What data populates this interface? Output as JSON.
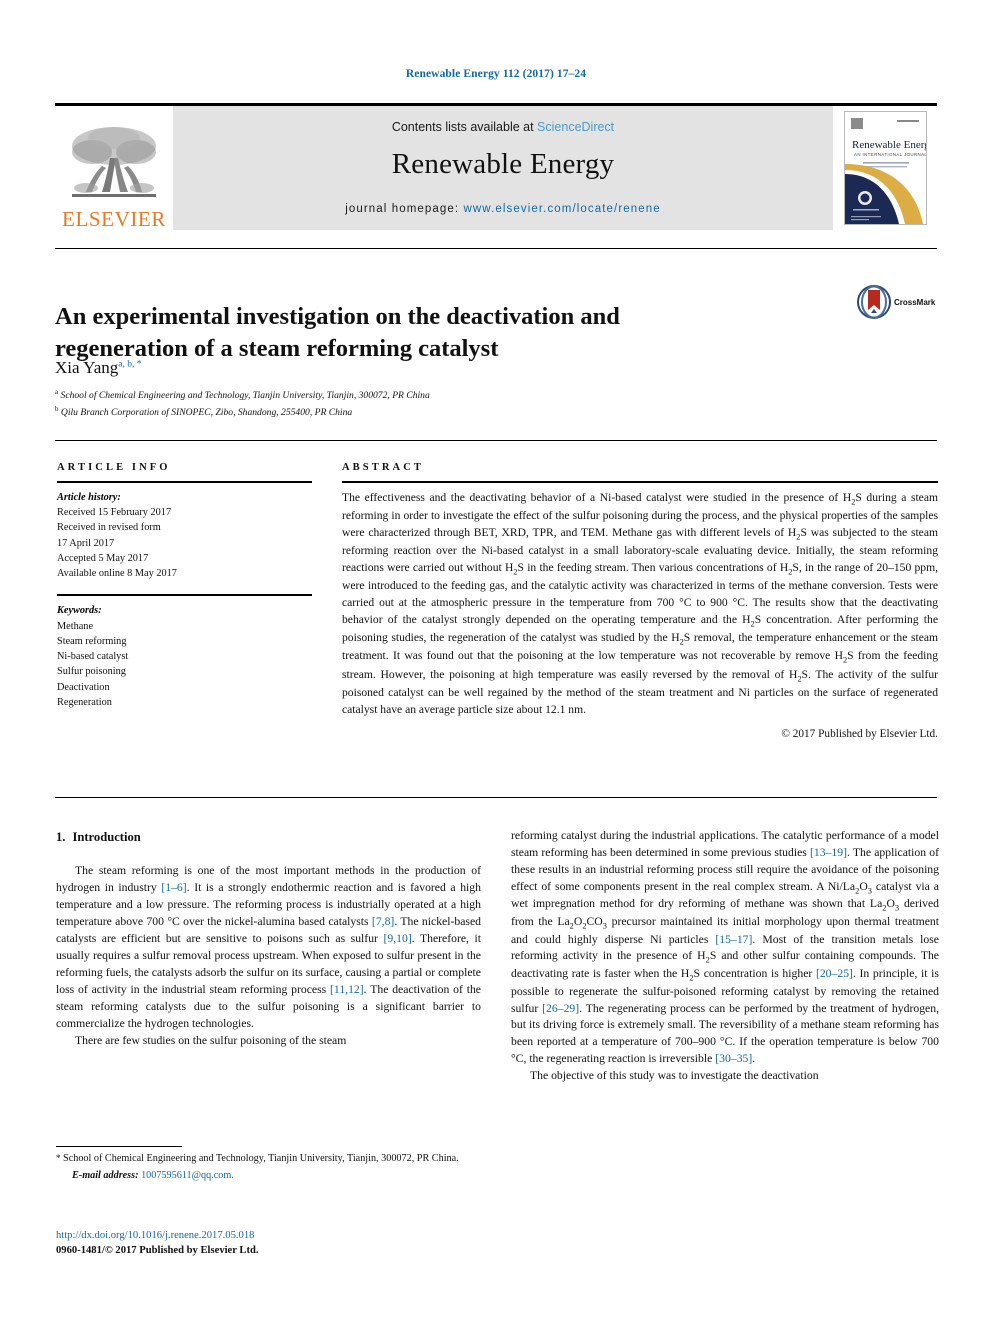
{
  "running_head": "Renewable Energy 112 (2017) 17–24",
  "masthead": {
    "publisher_name": "ELSEVIER",
    "contents_prefix": "Contents lists available at ",
    "contents_link": "ScienceDirect",
    "journal_name": "Renewable Energy",
    "homepage_label": "journal homepage:",
    "homepage_url": "www.elsevier.com/locate/renene",
    "cover": {
      "title": "Renewable Energy",
      "subtitle": "AN INTERNATIONAL JOURNAL"
    }
  },
  "article": {
    "title": "An experimental investigation on the deactivation and regeneration of a steam reforming catalyst",
    "crossmark_label": "CrossMark",
    "author": "Xia Yang",
    "author_marks": "a, b, *",
    "affiliations": [
      {
        "mark": "a",
        "text": "School of Chemical Engineering and Technology, Tianjin University, Tianjin, 300072, PR China"
      },
      {
        "mark": "b",
        "text": "Qilu Branch Corporation of SINOPEC, Zibo, Shandong, 255400, PR China"
      }
    ]
  },
  "article_info": {
    "heading": "ARTICLE INFO",
    "history_label": "Article history:",
    "history": [
      "Received 15 February 2017",
      "Received in revised form",
      "17 April 2017",
      "Accepted 5 May 2017",
      "Available online 8 May 2017"
    ],
    "keywords_label": "Keywords:",
    "keywords": [
      "Methane",
      "Steam reforming",
      "Ni-based catalyst",
      "Sulfur poisoning",
      "Deactivation",
      "Regeneration"
    ]
  },
  "abstract": {
    "heading": "ABSTRACT",
    "body": "The effectiveness and the deactivating behavior of a Ni-based catalyst were studied in the presence of H2S during a steam reforming in order to investigate the effect of the sulfur poisoning during the process, and the physical properties of the samples were characterized through BET, XRD, TPR, and TEM. Methane gas with different levels of H2S was subjected to the steam reforming reaction over the Ni-based catalyst in a small laboratory-scale evaluating device. Initially, the steam reforming reactions were carried out without H2S in the feeding stream. Then various concentrations of H2S, in the range of 20–150 ppm, were introduced to the feeding gas, and the catalytic activity was characterized in terms of the methane conversion. Tests were carried out at the atmospheric pressure in the temperature from 700 °C to 900 °C. The results show that the deactivating behavior of the catalyst strongly depended on the operating temperature and the H2S concentration. After performing the poisoning studies, the regeneration of the catalyst was studied by the H2S removal, the temperature enhancement or the steam treatment. It was found out that the poisoning at the low temperature was not recoverable by remove H2S from the feeding stream. However, the poisoning at high temperature was easily reversed by the removal of H2S. The activity of the sulfur poisoned catalyst can be well regained by the method of the steam treatment and Ni particles on the surface of regenerated catalyst have an average particle size about 12.1 nm.",
    "copyright": "© 2017 Published by Elsevier Ltd."
  },
  "introduction": {
    "number": "1.",
    "heading": "Introduction",
    "left_paragraph_1": "The steam reforming is one of the most important methods in the production of hydrogen in industry [1–6]. It is a strongly endothermic reaction and is favored a high temperature and a low pressure. The reforming process is industrially operated at a high temperature above 700 °C over the nickel-alumina based catalysts [7,8]. The nickel-based catalysts are efficient but are sensitive to poisons such as sulfur [9,10]. Therefore, it usually requires a sulfur removal process upstream. When exposed to sulfur present in the reforming fuels, the catalysts adsorb the sulfur on its surface, causing a partial or complete loss of activity in the industrial steam reforming process [11,12]. The deactivation of the steam reforming catalysts due to the sulfur poisoning is a significant barrier to commercialize the hydrogen technologies.",
    "left_paragraph_2": "There are few studies on the sulfur poisoning of the steam",
    "right_paragraph_1": "reforming catalyst during the industrial applications. The catalytic performance of a model steam reforming has been determined in some previous studies [13–19]. The application of these results in an industrial reforming process still require the avoidance of the poisoning effect of some components present in the real complex stream. A Ni/La2O3 catalyst via a wet impregnation method for dry reforming of methane was shown that La2O3 derived from the La2O2CO3 precursor maintained its initial morphology upon thermal treatment and could highly disperse Ni particles [15–17]. Most of the transition metals lose reforming activity in the presence of H2S and other sulfur containing compounds. The deactivating rate is faster when the H2S concentration is higher [20–25]. In principle, it is possible to regenerate the sulfur-poisoned reforming catalyst by removing the retained sulfur [26–29]. The regenerating process can be performed by the treatment of hydrogen, but its driving force is extremely small. The reversibility of a methane steam reforming has been reported at a temperature of 700–900 °C. If the operation temperature is below 700 °C, the regenerating reaction is irreversible [30–35].",
    "right_paragraph_2": "The objective of this study was to investigate the deactivation"
  },
  "footnote": {
    "star": "*",
    "text": "School of Chemical Engineering and Technology, Tianjin University, Tianjin, 300072, PR China.",
    "email_label": "E-mail address:",
    "email_address": "1007595611@qq.com."
  },
  "footer": {
    "doi": "http://dx.doi.org/10.1016/j.renene.2017.05.018",
    "issn_line": "0960-1481/© 2017 Published by Elsevier Ltd."
  },
  "colors": {
    "link_blue": "#1468a0",
    "sciencedirect_blue": "#4a9bc4",
    "elsevier_orange": "#e87722",
    "band_grey": "#e3e3e3"
  }
}
